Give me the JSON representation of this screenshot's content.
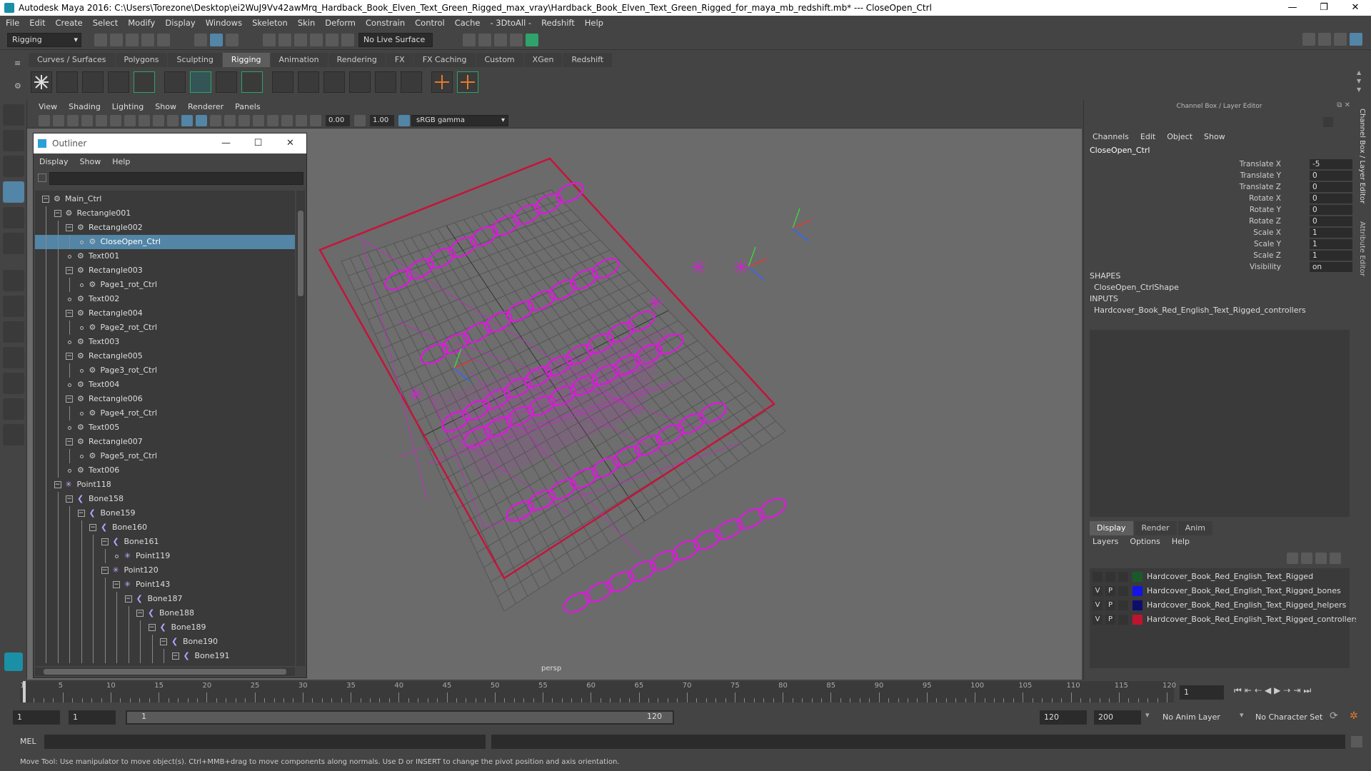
{
  "window": {
    "title": "Autodesk Maya 2016: C:\\Users\\Torezone\\Desktop\\ei2WuJ9Vv42awMrq_Hardback_Book_Elven_Text_Green_Rigged_max_vray\\Hardback_Book_Elven_Text_Green_Rigged_for_maya_mb_redshift.mb*  ---  CloseOpen_Ctrl",
    "minimize": "—",
    "maximize": "❐",
    "close": "✕"
  },
  "menubar": [
    "File",
    "Edit",
    "Create",
    "Select",
    "Modify",
    "Display",
    "Windows",
    "Skeleton",
    "Skin",
    "Deform",
    "Constrain",
    "Control",
    "Cache",
    "- 3DtoAll -",
    "Redshift",
    "Help"
  ],
  "status": {
    "mode": "Rigging",
    "live_surface": "No Live Surface"
  },
  "shelf": {
    "tabs": [
      "Curves / Surfaces",
      "Polygons",
      "Sculpting",
      "Rigging",
      "Animation",
      "Rendering",
      "FX",
      "FX Caching",
      "Custom",
      "XGen",
      "Redshift"
    ],
    "active": "Rigging"
  },
  "viewport": {
    "menu": [
      "View",
      "Shading",
      "Lighting",
      "Show",
      "Renderer",
      "Panels"
    ],
    "field1": "0.00",
    "field2": "1.00",
    "colorspace": "sRGB gamma",
    "camera": "persp",
    "accent": "#d41fd4",
    "border": "#c4143c"
  },
  "outliner": {
    "title": "Outliner",
    "menu": [
      "Display",
      "Show",
      "Help"
    ],
    "rows": [
      {
        "label": "Main_Ctrl",
        "depth": 0,
        "exp": "-",
        "type": "ctrl"
      },
      {
        "label": "Rectangle001",
        "depth": 1,
        "exp": "-",
        "type": "ctrl"
      },
      {
        "label": "Rectangle002",
        "depth": 2,
        "exp": "-",
        "type": "ctrl"
      },
      {
        "label": "CloseOpen_Ctrl",
        "depth": 3,
        "exp": "",
        "type": "ctrl",
        "sel": true
      },
      {
        "label": "Text001",
        "depth": 2,
        "exp": "",
        "type": "ctrl"
      },
      {
        "label": "Rectangle003",
        "depth": 2,
        "exp": "-",
        "type": "ctrl"
      },
      {
        "label": "Page1_rot_Ctrl",
        "depth": 3,
        "exp": "",
        "type": "ctrl"
      },
      {
        "label": "Text002",
        "depth": 2,
        "exp": "",
        "type": "ctrl"
      },
      {
        "label": "Rectangle004",
        "depth": 2,
        "exp": "-",
        "type": "ctrl"
      },
      {
        "label": "Page2_rot_Ctrl",
        "depth": 3,
        "exp": "",
        "type": "ctrl"
      },
      {
        "label": "Text003",
        "depth": 2,
        "exp": "",
        "type": "ctrl"
      },
      {
        "label": "Rectangle005",
        "depth": 2,
        "exp": "-",
        "type": "ctrl"
      },
      {
        "label": "Page3_rot_Ctrl",
        "depth": 3,
        "exp": "",
        "type": "ctrl"
      },
      {
        "label": "Text004",
        "depth": 2,
        "exp": "",
        "type": "ctrl"
      },
      {
        "label": "Rectangle006",
        "depth": 2,
        "exp": "-",
        "type": "ctrl"
      },
      {
        "label": "Page4_rot_Ctrl",
        "depth": 3,
        "exp": "",
        "type": "ctrl"
      },
      {
        "label": "Text005",
        "depth": 2,
        "exp": "",
        "type": "ctrl"
      },
      {
        "label": "Rectangle007",
        "depth": 2,
        "exp": "-",
        "type": "ctrl"
      },
      {
        "label": "Page5_rot_Ctrl",
        "depth": 3,
        "exp": "",
        "type": "ctrl"
      },
      {
        "label": "Text006",
        "depth": 2,
        "exp": "",
        "type": "ctrl"
      },
      {
        "label": "Point118",
        "depth": 1,
        "exp": "-",
        "type": "point"
      },
      {
        "label": "Bone158",
        "depth": 2,
        "exp": "-",
        "type": "bone"
      },
      {
        "label": "Bone159",
        "depth": 3,
        "exp": "-",
        "type": "bone"
      },
      {
        "label": "Bone160",
        "depth": 4,
        "exp": "-",
        "type": "bone"
      },
      {
        "label": "Bone161",
        "depth": 5,
        "exp": "-",
        "type": "bone"
      },
      {
        "label": "Point119",
        "depth": 6,
        "exp": "",
        "type": "point"
      },
      {
        "label": "Point120",
        "depth": 5,
        "exp": "-",
        "type": "point"
      },
      {
        "label": "Point143",
        "depth": 6,
        "exp": "-",
        "type": "point"
      },
      {
        "label": "Bone187",
        "depth": 7,
        "exp": "-",
        "type": "bone"
      },
      {
        "label": "Bone188",
        "depth": 8,
        "exp": "-",
        "type": "bone"
      },
      {
        "label": "Bone189",
        "depth": 9,
        "exp": "-",
        "type": "bone"
      },
      {
        "label": "Bone190",
        "depth": 10,
        "exp": "-",
        "type": "bone"
      },
      {
        "label": "Bone191",
        "depth": 11,
        "exp": "-",
        "type": "bone"
      }
    ]
  },
  "channel": {
    "title": "Channel Box / Layer Editor",
    "menu": [
      "Channels",
      "Edit",
      "Object",
      "Show"
    ],
    "object": "CloseOpen_Ctrl",
    "attrs": [
      {
        "name": "Translate X",
        "value": "-5"
      },
      {
        "name": "Translate Y",
        "value": "0"
      },
      {
        "name": "Translate Z",
        "value": "0"
      },
      {
        "name": "Rotate X",
        "value": "0"
      },
      {
        "name": "Rotate Y",
        "value": "0"
      },
      {
        "name": "Rotate Z",
        "value": "0"
      },
      {
        "name": "Scale X",
        "value": "1"
      },
      {
        "name": "Scale Y",
        "value": "1"
      },
      {
        "name": "Scale Z",
        "value": "1"
      },
      {
        "name": "Visibility",
        "value": "on"
      }
    ],
    "shapes_label": "SHAPES",
    "shape": "CloseOpen_CtrlShape",
    "inputs_label": "INPUTS",
    "input": "Hardcover_Book_Red_English_Text_Rigged_controllers"
  },
  "layers": {
    "tabs": [
      "Display",
      "Render",
      "Anim"
    ],
    "active": "Display",
    "menu": [
      "Layers",
      "Options",
      "Help"
    ],
    "rows": [
      {
        "v": "",
        "p": "",
        "color": "#1a5a2a",
        "name": "Hardcover_Book_Red_English_Text_Rigged"
      },
      {
        "v": "V",
        "p": "P",
        "color": "#1414e6",
        "name": "Hardcover_Book_Red_English_Text_Rigged_bones"
      },
      {
        "v": "V",
        "p": "P",
        "color": "#0d0d6e",
        "name": "Hardcover_Book_Red_English_Text_Rigged_helpers"
      },
      {
        "v": "V",
        "p": "P",
        "color": "#c0142e",
        "name": "Hardcover_Book_Red_English_Text_Rigged_controllers"
      }
    ]
  },
  "side_tabs": [
    "Channel Box / Layer Editor",
    "Attribute Editor"
  ],
  "timeline": {
    "ticks": [
      1,
      5,
      10,
      15,
      20,
      25,
      30,
      35,
      40,
      45,
      50,
      55,
      60,
      65,
      70,
      75,
      80,
      85,
      90,
      95,
      100,
      105,
      110,
      115,
      120
    ],
    "current": "1",
    "min": 1,
    "max": 120
  },
  "range": {
    "start": "1",
    "playstart": "1",
    "slider_left": "1",
    "slider_right": "120",
    "playend": "120",
    "end": "200",
    "anim_layer": "No Anim Layer",
    "char_set": "No Character Set"
  },
  "cmd": {
    "label": "MEL"
  },
  "help": "Move Tool: Use manipulator to move object(s). Ctrl+MMB+drag to move components along normals. Use D or INSERT to change the pivot position and axis orientation."
}
